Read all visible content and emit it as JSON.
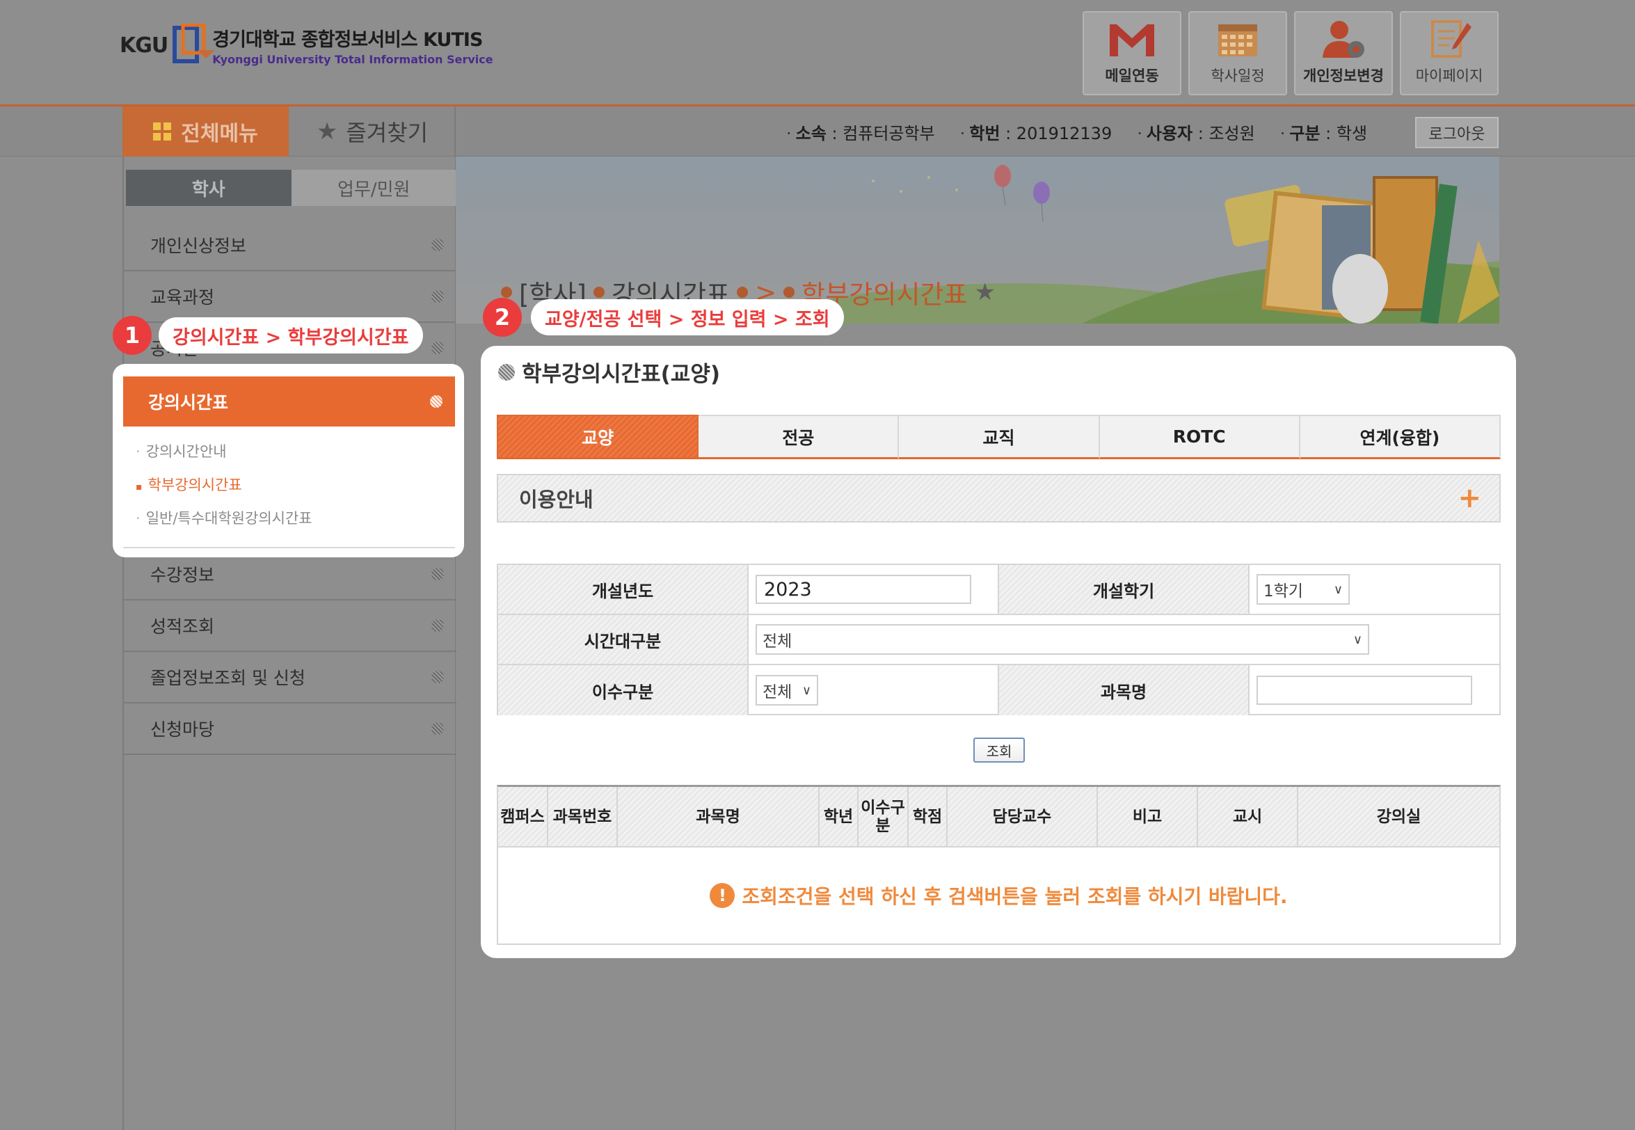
{
  "header": {
    "logo_abbr": "KGU",
    "logo_title": "경기대학교 종합정보서비스 KUTIS",
    "logo_subtitle": "Kyonggi University Total Information Service",
    "top_buttons": [
      {
        "label": "메일연동",
        "icon": "mail-icon"
      },
      {
        "label": "학사일정",
        "icon": "calendar-icon"
      },
      {
        "label": "개인정보변경",
        "icon": "user-settings-icon"
      },
      {
        "label": "마이페이지",
        "icon": "mypage-icon"
      }
    ]
  },
  "menubar": {
    "all_menu": "전체메뉴",
    "favorites": "즐겨찾기",
    "user_info": [
      {
        "label": "소속",
        "value": " : 컴퓨터공학부"
      },
      {
        "label": "학번",
        "value": " : 201912139"
      },
      {
        "label": "사용자",
        "value": " : 조성원"
      },
      {
        "label": "구분",
        "value": " : 학생"
      }
    ],
    "logout": "로그아웃"
  },
  "sidebar": {
    "tabs": [
      "학사",
      "업무/민원"
    ],
    "items_top": [
      "개인신상정보",
      "교육과정",
      "공지관"
    ],
    "active_item": "강의시간표",
    "sub_items": [
      "강의시간안내",
      "학부강의시간표",
      "일반/특수대학원강의시간표"
    ],
    "items_bottom": [
      "수강정보",
      "성적조회",
      "졸업정보조회 및 신청",
      "신청마당"
    ]
  },
  "breadcrumb": {
    "root": "[학사]",
    "parent": "강의시간표",
    "arrow": ">",
    "current": "학부강의시간표"
  },
  "callouts": {
    "step1_num": "1",
    "step1_text": "강의시간표 > 학부강의시간표",
    "step2_num": "2",
    "step2_text": "교양/전공 선택 > 정보 입력 > 조회"
  },
  "main": {
    "title": "학부강의시간표(교양)",
    "tabs": [
      "교양",
      "전공",
      "교직",
      "ROTC",
      "연계(융합)"
    ],
    "info_bar": "이용안내",
    "info_plus": "+",
    "form": {
      "year_label": "개설년도",
      "year_value": "2023",
      "semester_label": "개설학기",
      "semester_value": "1학기",
      "timeslot_label": "시간대구분",
      "timeslot_value": "전체",
      "category_label": "이수구분",
      "category_value": "전체",
      "course_label": "과목명",
      "course_value": ""
    },
    "search_button": "조회",
    "table_headers": [
      "캠퍼스",
      "과목번호",
      "과목명",
      "학년",
      "이수구분",
      "학점",
      "담당교수",
      "비고",
      "교시",
      "강의실"
    ],
    "empty_message": "조회조건을 선택 하신 후 검색버튼을 눌러 조회를 하시기 바랍니다.",
    "warn_glyph": "!"
  }
}
